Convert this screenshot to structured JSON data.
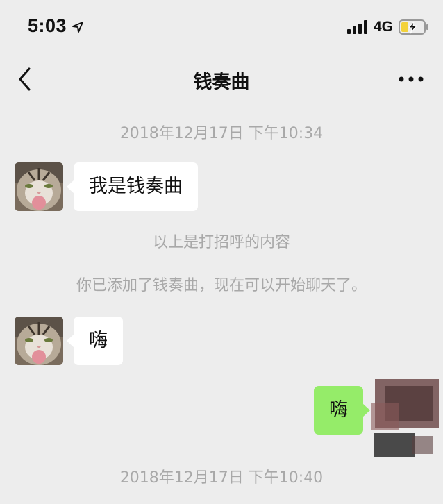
{
  "status_bar": {
    "time": "5:03",
    "network": "4G",
    "icons": [
      "location-arrow-icon",
      "signal-bars-icon",
      "battery-charging-icon"
    ]
  },
  "nav": {
    "title": "钱奏曲",
    "back_icon": "chevron-left-icon",
    "more_icon": "more-dots-icon"
  },
  "chat": {
    "timestamp_1": "2018年12月17日 下午10:34",
    "message_1": {
      "sender": "contact",
      "text": "我是钱奏曲"
    },
    "system_1": "以上是打招呼的内容",
    "system_2": "你已添加了钱奏曲，现在可以开始聊天了。",
    "message_2": {
      "sender": "contact",
      "text": "嗨"
    },
    "message_3": {
      "sender": "self",
      "text": "嗨"
    },
    "timestamp_2": "2018年12月17日 下午10:40"
  },
  "colors": {
    "background": "#ededed",
    "incoming_bubble": "#ffffff",
    "outgoing_bubble": "#95ec69",
    "meta_text": "#a8a8a8"
  }
}
